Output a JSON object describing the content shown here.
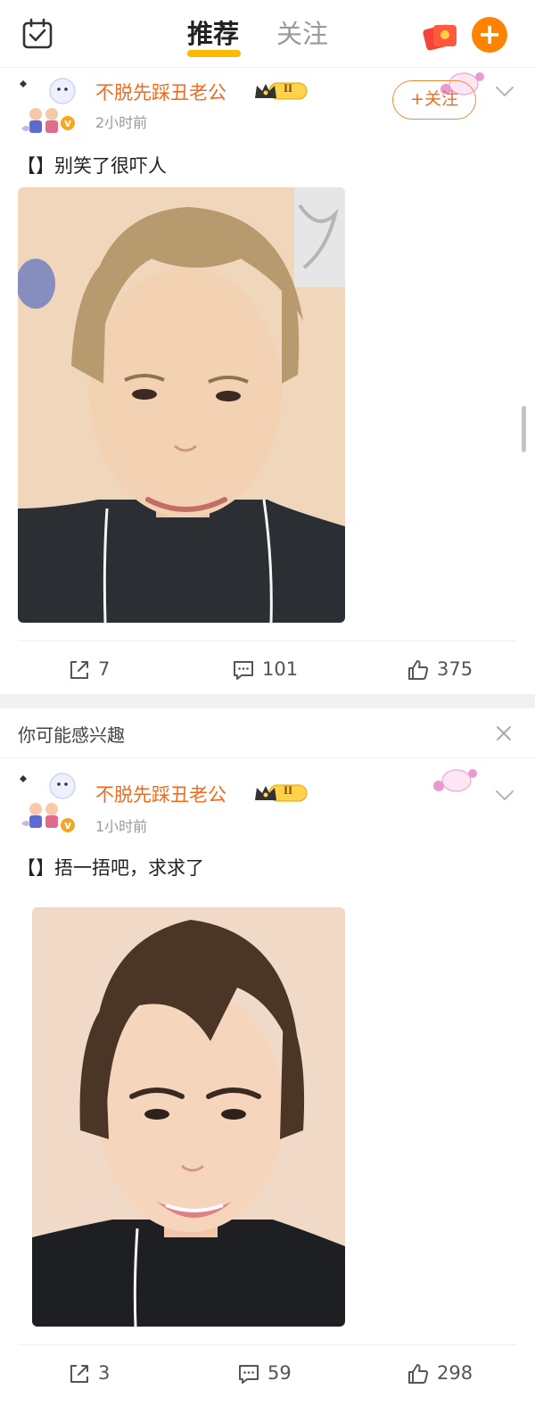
{
  "header": {
    "tabs": [
      {
        "label": "推荐",
        "active": true
      },
      {
        "label": "关注",
        "active": false
      }
    ],
    "plus_label": "+"
  },
  "posts": [
    {
      "username": "不脱先踩丑老公",
      "vip_level": "II",
      "timestamp": "2小时前",
      "follow_label": "+关注",
      "text": "【】别笑了很吓人",
      "photo_hair": "#b79a6e",
      "reposts": "7",
      "comments": "101",
      "likes": "375"
    },
    {
      "username": "不脱先踩丑老公",
      "vip_level": "II",
      "timestamp": "1小时前",
      "text": "【】捂一捂吧，求求了",
      "photo_hair": "#4a3526",
      "reposts": "3",
      "comments": "59",
      "likes": "298"
    }
  ],
  "recommend_bar": {
    "title": "你可能感兴趣"
  },
  "colors": {
    "accent": "#ff8200",
    "username": "#f26b1d",
    "tab_underline": "#ffb800"
  },
  "icons": [
    "checkin-icon",
    "red-packet-icon",
    "plus-icon",
    "chevron-down-icon",
    "repost-icon",
    "comment-icon",
    "like-icon",
    "close-icon"
  ]
}
